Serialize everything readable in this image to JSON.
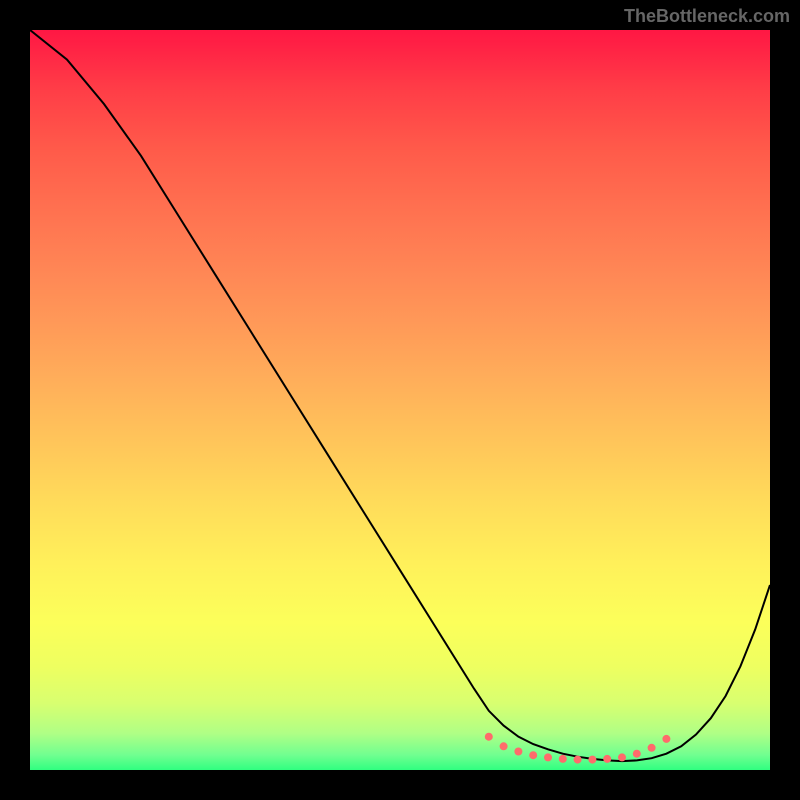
{
  "watermark": "TheBottleneck.com",
  "chart_data": {
    "type": "line",
    "title": "",
    "xlabel": "",
    "ylabel": "",
    "xlim": [
      0,
      100
    ],
    "ylim": [
      0,
      100
    ],
    "series": [
      {
        "name": "curve",
        "x": [
          0,
          5,
          10,
          15,
          20,
          25,
          30,
          35,
          40,
          45,
          50,
          55,
          60,
          62,
          64,
          66,
          68,
          70,
          72,
          74,
          76,
          78,
          80,
          82,
          84,
          86,
          88,
          90,
          92,
          94,
          96,
          98,
          100
        ],
        "y": [
          100,
          96,
          90,
          83,
          75,
          67,
          59,
          51,
          43,
          35,
          27,
          19,
          11,
          8,
          6,
          4.5,
          3.5,
          2.8,
          2.2,
          1.8,
          1.5,
          1.3,
          1.2,
          1.3,
          1.6,
          2.2,
          3.2,
          4.8,
          7,
          10,
          14,
          19,
          25
        ]
      }
    ],
    "markers": {
      "name": "dots",
      "x": [
        62,
        64,
        66,
        68,
        70,
        72,
        74,
        76,
        78,
        80,
        82,
        84,
        86
      ],
      "y": [
        4.5,
        3.2,
        2.5,
        2.0,
        1.7,
        1.5,
        1.4,
        1.4,
        1.5,
        1.7,
        2.2,
        3.0,
        4.2
      ],
      "color": "#ff6b6b"
    }
  }
}
